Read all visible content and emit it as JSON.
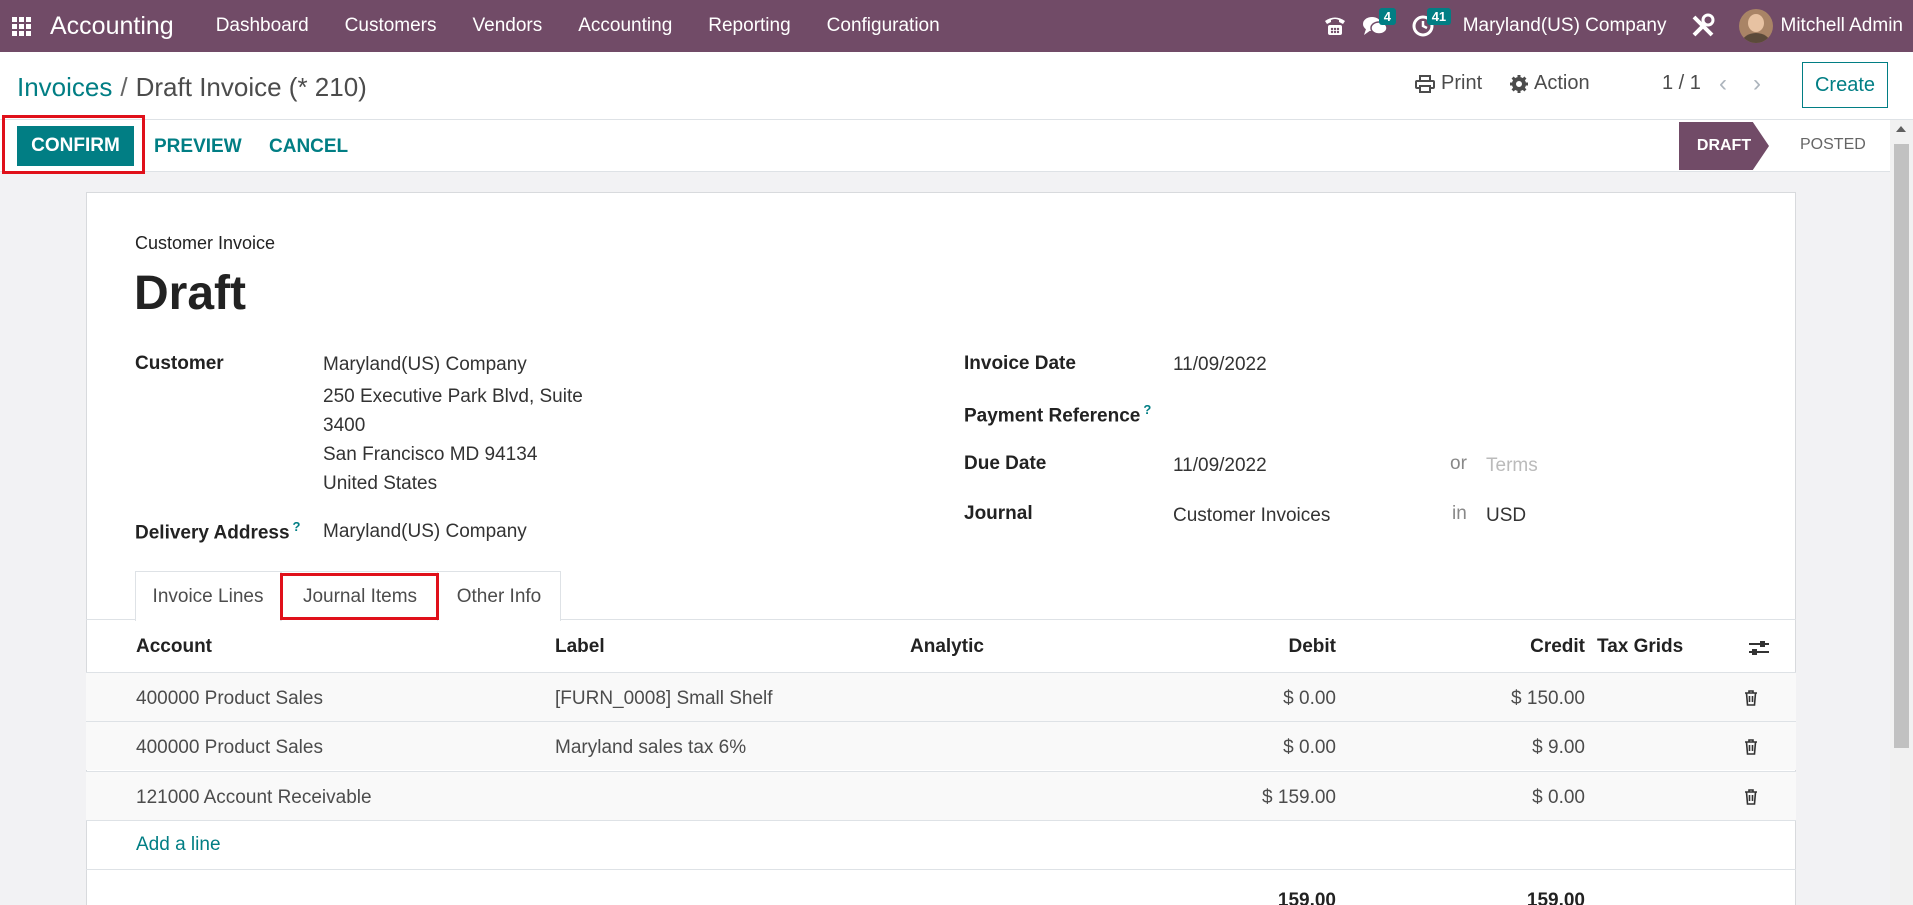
{
  "navbar": {
    "brand": "Accounting",
    "menu": [
      "Dashboard",
      "Customers",
      "Vendors",
      "Accounting",
      "Reporting",
      "Configuration"
    ],
    "messages_count": "4",
    "activities_count": "41",
    "company": "Maryland(US) Company",
    "user": "Mitchell Admin"
  },
  "breadcrumb": {
    "parent": "Invoices",
    "current": "Draft Invoice (* 210)"
  },
  "control": {
    "print": "Print",
    "action": "Action",
    "pager": "1 / 1",
    "create": "Create"
  },
  "buttons": {
    "confirm": "CONFIRM",
    "preview": "PREVIEW",
    "cancel": "CANCEL"
  },
  "status": {
    "draft": "DRAFT",
    "posted": "POSTED"
  },
  "document": {
    "subtitle": "Customer Invoice",
    "title": "Draft"
  },
  "fields": {
    "customer_label": "Customer",
    "customer_name": "Maryland(US) Company",
    "address_line1": "250 Executive Park Blvd, Suite",
    "address_line2": "3400",
    "address_line3": "San Francisco MD 94134",
    "address_line4": "United States",
    "delivery_label": "Delivery Address",
    "delivery_value": "Maryland(US) Company",
    "invoice_date_label": "Invoice Date",
    "invoice_date_value": "11/09/2022",
    "payment_ref_label": "Payment Reference",
    "due_date_label": "Due Date",
    "due_date_value": "11/09/2022",
    "or_text": "or",
    "terms_placeholder": "Terms",
    "journal_label": "Journal",
    "journal_value": "Customer Invoices",
    "in_text": "in",
    "currency": "USD",
    "help_mark": "?"
  },
  "tabs": [
    "Invoice Lines",
    "Journal Items",
    "Other Info"
  ],
  "table": {
    "headers": {
      "account": "Account",
      "label": "Label",
      "analytic": "Analytic",
      "debit": "Debit",
      "credit": "Credit",
      "tax_grids": "Tax Grids"
    },
    "rows": [
      {
        "account": "400000 Product Sales",
        "label": "[FURN_0008] Small Shelf",
        "debit": "$ 0.00",
        "credit": "$ 150.00"
      },
      {
        "account": "400000 Product Sales",
        "label": "Maryland sales tax 6%",
        "debit": "$ 0.00",
        "credit": "$ 9.00"
      },
      {
        "account": "121000 Account Receivable",
        "label": "",
        "debit": "$ 159.00",
        "credit": "$ 0.00"
      }
    ],
    "add_line": "Add a line",
    "total_debit": "159.00",
    "total_credit": "159.00"
  },
  "colors": {
    "brand": "#714b67",
    "accent": "#017e84",
    "highlight": "#e0101a"
  }
}
